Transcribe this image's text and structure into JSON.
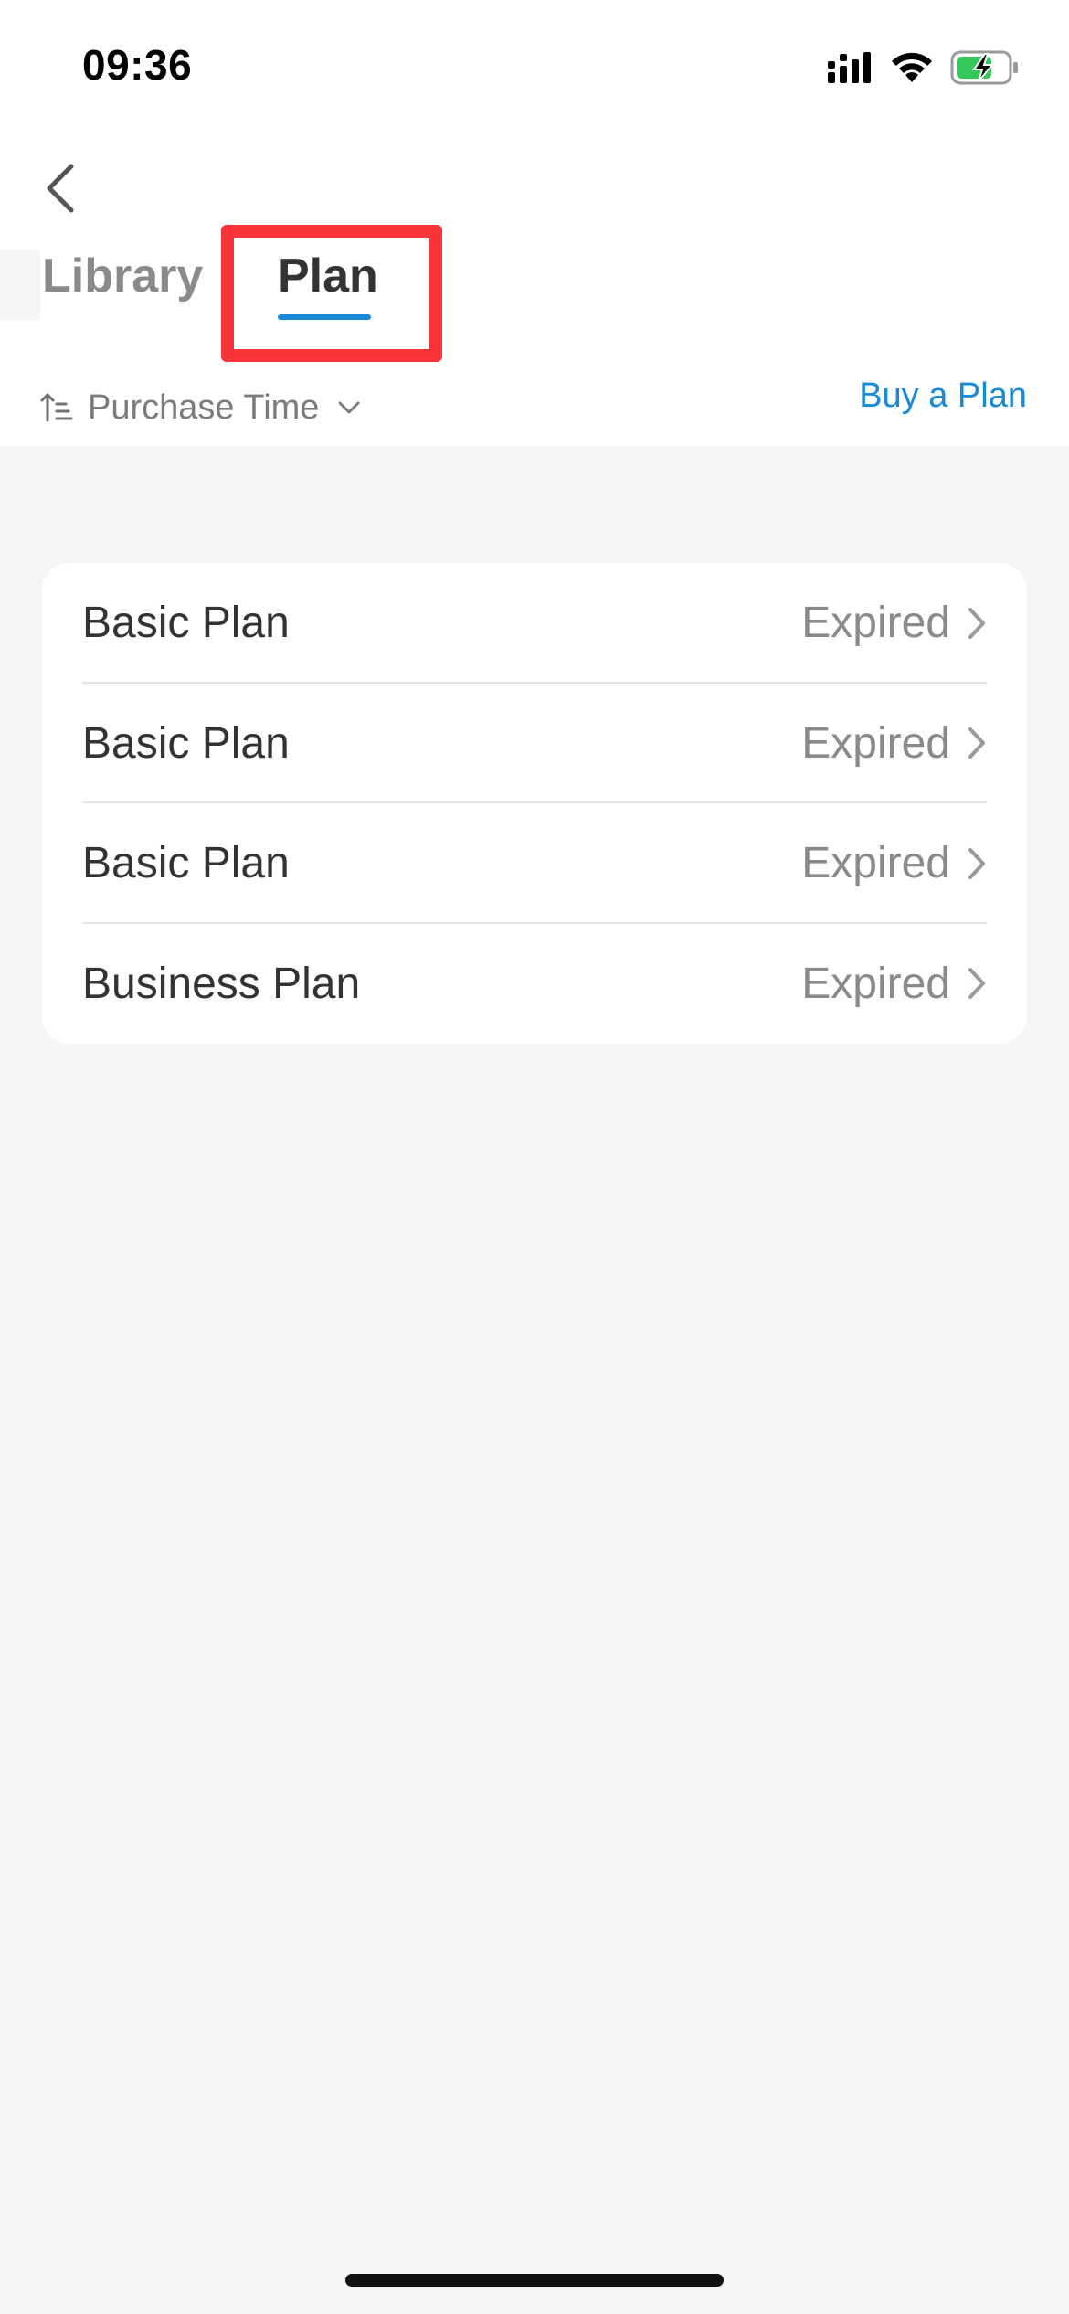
{
  "status_bar": {
    "time": "09:36",
    "signal_icon": "signal-bars-icon",
    "wifi_icon": "wifi-icon",
    "battery_icon": "battery-charging-icon",
    "battery_color": "#35c759"
  },
  "nav": {
    "back_icon": "chevron-left-icon",
    "tabs": [
      {
        "label": "Library",
        "active": false
      },
      {
        "label": "Plan",
        "active": true
      }
    ],
    "active_color": "#1a8ad8",
    "highlight_color": "#f73539"
  },
  "toolbar": {
    "sort_icon": "sort-ascending-icon",
    "sort_label": "Purchase Time",
    "sort_chevron": "chevron-down-icon",
    "buy_label": "Buy a Plan"
  },
  "plans": [
    {
      "name": "Basic Plan",
      "status": "Expired"
    },
    {
      "name": "Basic Plan",
      "status": "Expired"
    },
    {
      "name": "Basic Plan",
      "status": "Expired"
    },
    {
      "name": "Business Plan",
      "status": "Expired"
    }
  ]
}
